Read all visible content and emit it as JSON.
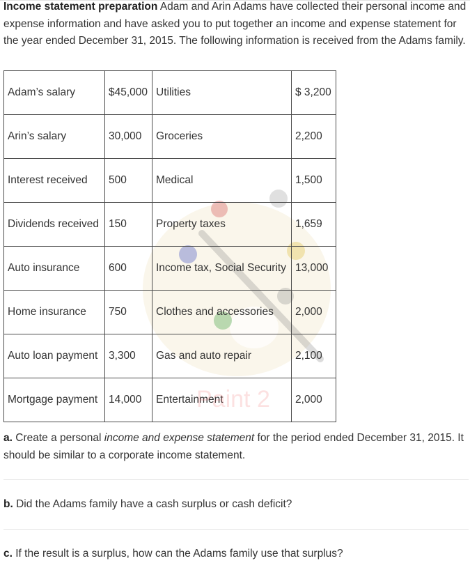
{
  "intro": {
    "title": "Income statement preparation",
    "text": "Adam and Arin Adams have collected their personal income and expense information and have asked you to put together an income and expense statement for the year ended December 31, 2015. The following information is received from the Adams family."
  },
  "table": {
    "rows": [
      {
        "income_item": "Adam’s salary",
        "income_amount": "$45,000",
        "expense_item": "Utilities",
        "expense_amount": "$ 3,200"
      },
      {
        "income_item": "Arin’s salary",
        "income_amount": "30,000",
        "expense_item": "Groceries",
        "expense_amount": "2,200"
      },
      {
        "income_item": "Interest received",
        "income_amount": "500",
        "expense_item": "Medical",
        "expense_amount": "1,500"
      },
      {
        "income_item": "Dividends received",
        "income_amount": "150",
        "expense_item": "Property taxes",
        "expense_amount": "1,659"
      },
      {
        "income_item": "Auto insurance",
        "income_amount": "600",
        "expense_item": "Income tax, Social Security",
        "expense_amount": "13,000"
      },
      {
        "income_item": "Home insurance",
        "income_amount": "750",
        "expense_item": "Clothes and accessories",
        "expense_amount": "2,000"
      },
      {
        "income_item": "Auto loan payment",
        "income_amount": "3,300",
        "expense_item": "Gas and auto repair",
        "expense_amount": "2,100"
      },
      {
        "income_item": "Mortgage payment",
        "income_amount": "14,000",
        "expense_item": "Entertainment",
        "expense_amount": "2,000"
      }
    ]
  },
  "watermark": {
    "text": "Paint 2",
    "icon": "paint-palette-icon"
  },
  "questions": {
    "a": {
      "label": "a.",
      "text_before": "Create a personal ",
      "emphasis": "income and expense statement",
      "text_after": " for the period ended December 31, 2015. It should be similar to a corporate income statement."
    },
    "b": {
      "label": "b.",
      "text": "Did the Adams family have a cash surplus or cash deficit?"
    },
    "c": {
      "label": "c.",
      "text": "If the result is a surplus, how can the Adams family use that surplus?"
    }
  }
}
